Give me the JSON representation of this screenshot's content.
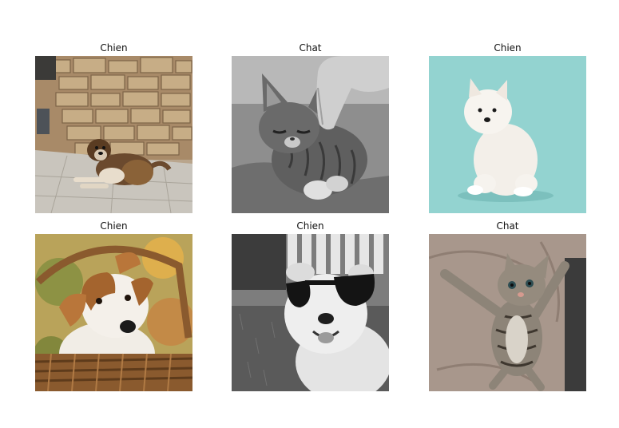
{
  "panels": [
    {
      "title": "Chien",
      "subject": "dog lying on stone pavement in front of a brick and stone wall",
      "color_mode": "color"
    },
    {
      "title": "Chat",
      "subject": "tabby kitten being petted by a hand",
      "color_mode": "grayscale"
    },
    {
      "title": "Chien",
      "subject": "white fluffy puppy sitting on teal background",
      "color_mode": "color"
    },
    {
      "title": "Chien",
      "subject": "jack russell terrier puppy in a wicker basket",
      "color_mode": "color"
    },
    {
      "title": "Chien",
      "subject": "small white dog wearing sunglasses on grass",
      "color_mode": "grayscale"
    },
    {
      "title": "Chat",
      "subject": "tabby kitten lying on its back on a blanket",
      "color_mode": "color"
    }
  ],
  "colors": {
    "teal_background": "#93d3d0",
    "blanket": "#a8978c",
    "wicker": "#8a5a2e"
  }
}
